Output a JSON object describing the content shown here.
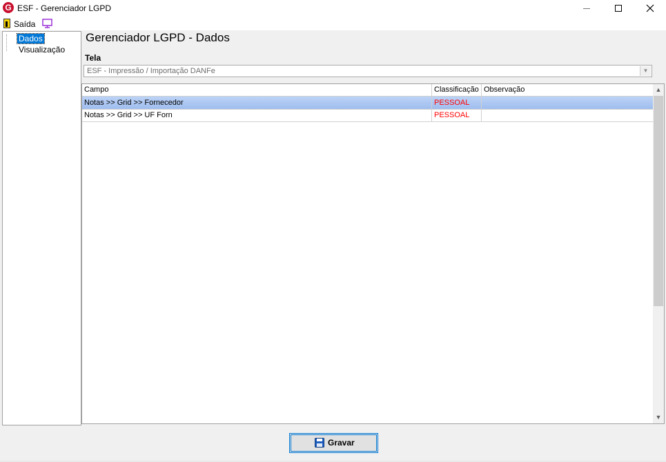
{
  "window": {
    "title": "ESF - Gerenciador LGPD",
    "app_icon_letter": "G"
  },
  "menu": {
    "exit_label": "Saída"
  },
  "tree": {
    "items": [
      {
        "label": "Dados",
        "selected": true
      },
      {
        "label": "Visualização",
        "selected": false
      }
    ]
  },
  "main": {
    "title": "Gerenciador LGPD - Dados",
    "tela_label": "Tela",
    "tela_value": "ESF - Impressão / Importação DANFe"
  },
  "grid": {
    "columns": [
      "Campo",
      "Classificação",
      "Observação"
    ],
    "rows": [
      {
        "campo": "Notas >> Grid >> Fornecedor",
        "classificacao": "PESSOAL",
        "observacao": "",
        "selected": true
      },
      {
        "campo": "Notas >> Grid >> UF Forn",
        "classificacao": "PESSOAL",
        "observacao": "",
        "selected": false
      }
    ]
  },
  "footer": {
    "save_label": "Gravar"
  },
  "colors": {
    "selection": "#0078d7",
    "row_highlight": "#b0c9f3",
    "classification": "#ff0000",
    "title_bar": "#ffffff"
  },
  "icons": [
    "app-logo-icon",
    "exit-door-icon",
    "monitor-icon",
    "floppy-save-icon",
    "minimize-icon",
    "maximize-icon",
    "close-icon",
    "chevron-down-icon"
  ]
}
